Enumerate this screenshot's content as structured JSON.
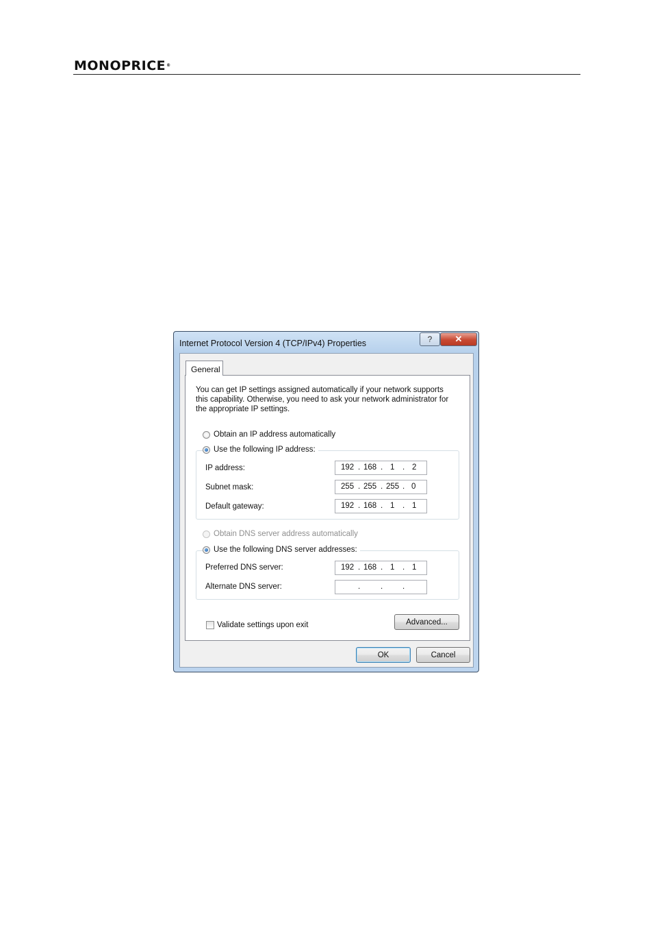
{
  "header": {
    "logo_text": "MONOPRICE",
    "logo_mark": "®"
  },
  "dialog": {
    "title": "Internet Protocol Version 4 (TCP/IPv4) Properties",
    "help_label": "?",
    "close_label": "✕",
    "tab_label": "General",
    "description": "You can get IP settings assigned automatically if your network supports this capability. Otherwise, you need to ask your network administrator for the appropriate IP settings.",
    "ip_auto_label": "Obtain an IP address automatically",
    "ip_manual_label": "Use the following IP address:",
    "ip_mode_selected": "manual",
    "ip_fields": [
      {
        "label": "IP address:",
        "octets": [
          "192",
          "168",
          "1",
          "2"
        ]
      },
      {
        "label": "Subnet mask:",
        "octets": [
          "255",
          "255",
          "255",
          "0"
        ]
      },
      {
        "label": "Default gateway:",
        "octets": [
          "192",
          "168",
          "1",
          "1"
        ]
      }
    ],
    "dns_auto_label": "Obtain DNS server address automatically",
    "dns_manual_label": "Use the following DNS server addresses:",
    "dns_mode_selected": "manual",
    "dns_fields": [
      {
        "label": "Preferred DNS server:",
        "octets": [
          "192",
          "168",
          "1",
          "1"
        ]
      },
      {
        "label": "Alternate DNS server:",
        "octets": [
          "",
          "",
          "",
          ""
        ]
      }
    ],
    "dot": ".",
    "validate_label": "Validate settings upon exit",
    "validate_checked": false,
    "advanced_label": "Advanced...",
    "ok_label": "OK",
    "cancel_label": "Cancel"
  }
}
